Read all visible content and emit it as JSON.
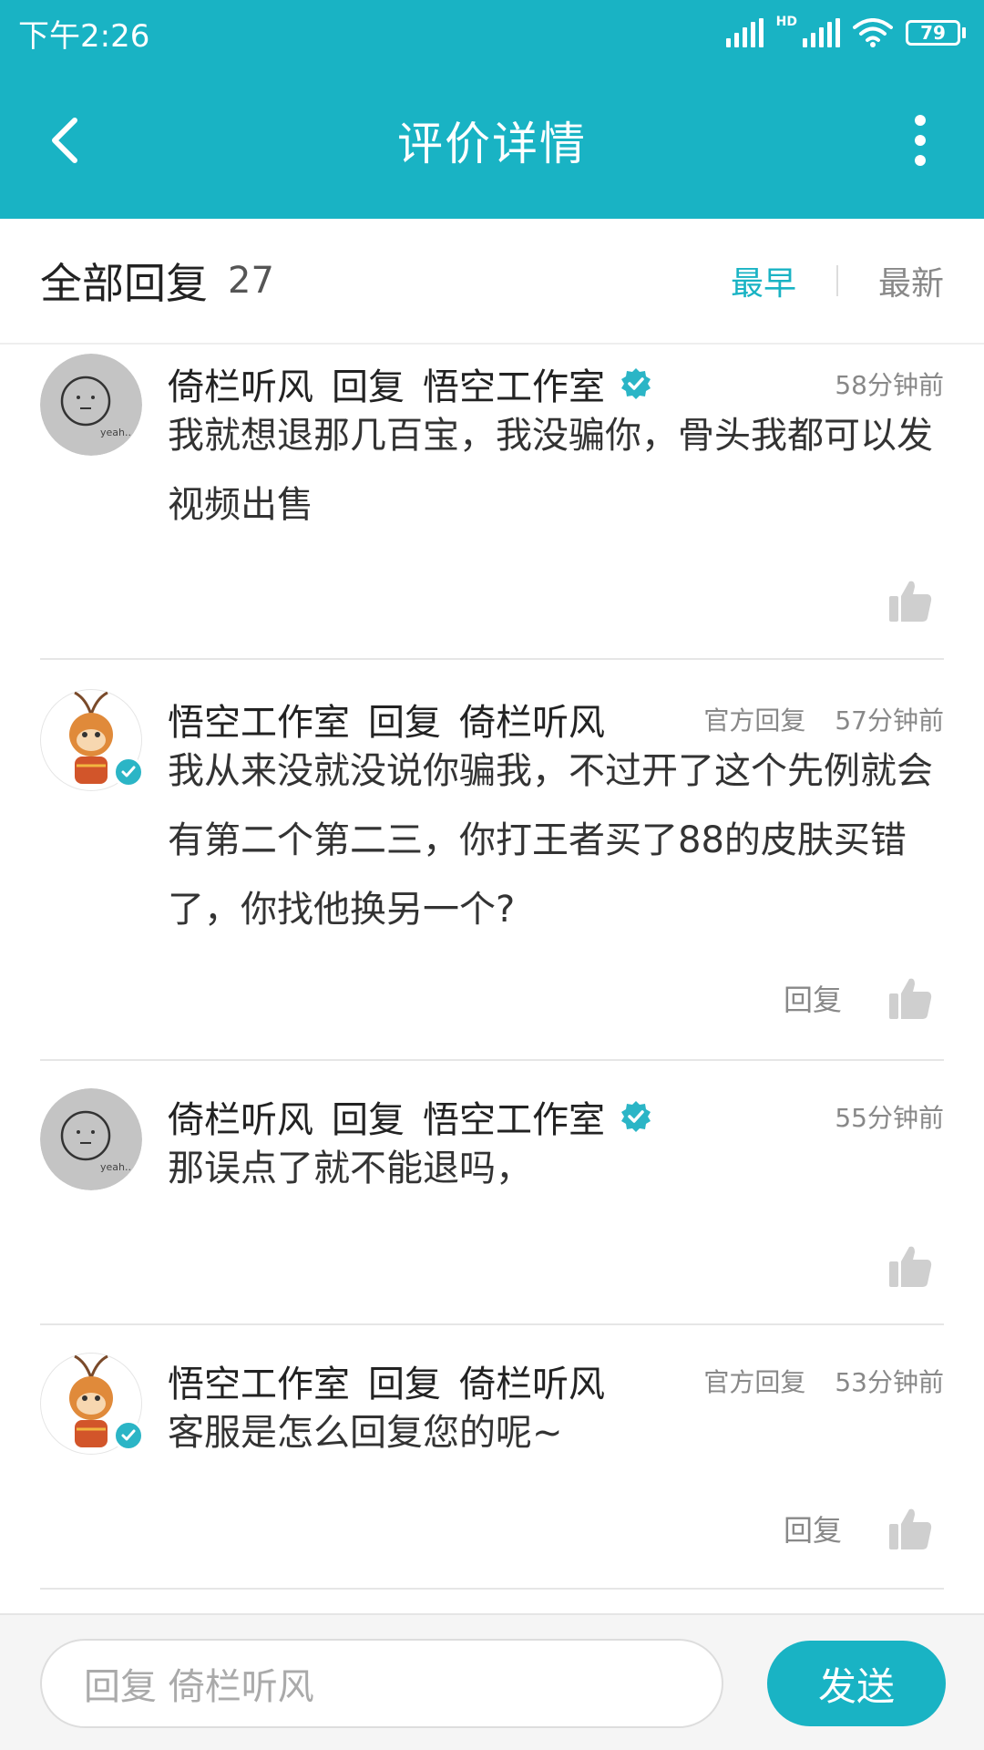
{
  "status_bar": {
    "time": "下午2:26",
    "hd_label": "HD",
    "battery": "79"
  },
  "header": {
    "title": "评价详情"
  },
  "tabs": {
    "label": "全部回复",
    "count": "27",
    "sort_earliest": "最早",
    "sort_latest": "最新"
  },
  "comments": [
    {
      "author": "倚栏听风",
      "reply_word": "回复",
      "target": "悟空工作室",
      "official": "",
      "time": "58分钟前",
      "text": "我就想退那几百宝，我没骗你，骨头我都可以发视频出售",
      "reply_label": ""
    },
    {
      "author": "悟空工作室",
      "reply_word": "回复",
      "target": "倚栏听风",
      "official": "官方回复",
      "time": "57分钟前",
      "text": "我从来没就没说你骗我，不过开了这个先例就会有第二个第二三，你打王者买了88的皮肤买错了，你找他换另一个?",
      "reply_label": "回复"
    },
    {
      "author": "倚栏听风",
      "reply_word": "回复",
      "target": "悟空工作室",
      "official": "",
      "time": "55分钟前",
      "text": "那误点了就不能退吗，",
      "reply_label": ""
    },
    {
      "author": "悟空工作室",
      "reply_word": "回复",
      "target": "倚栏听风",
      "official": "官方回复",
      "time": "53分钟前",
      "text": "客服是怎么回复您的呢~",
      "reply_label": "回复"
    }
  ],
  "avatar_text": {
    "user": "yeah.."
  },
  "reply_bar": {
    "placeholder": "回复 倚栏听风",
    "send_label": "发送"
  },
  "colors": {
    "accent": "#19b3c4",
    "verified": "#2bb5c6"
  }
}
